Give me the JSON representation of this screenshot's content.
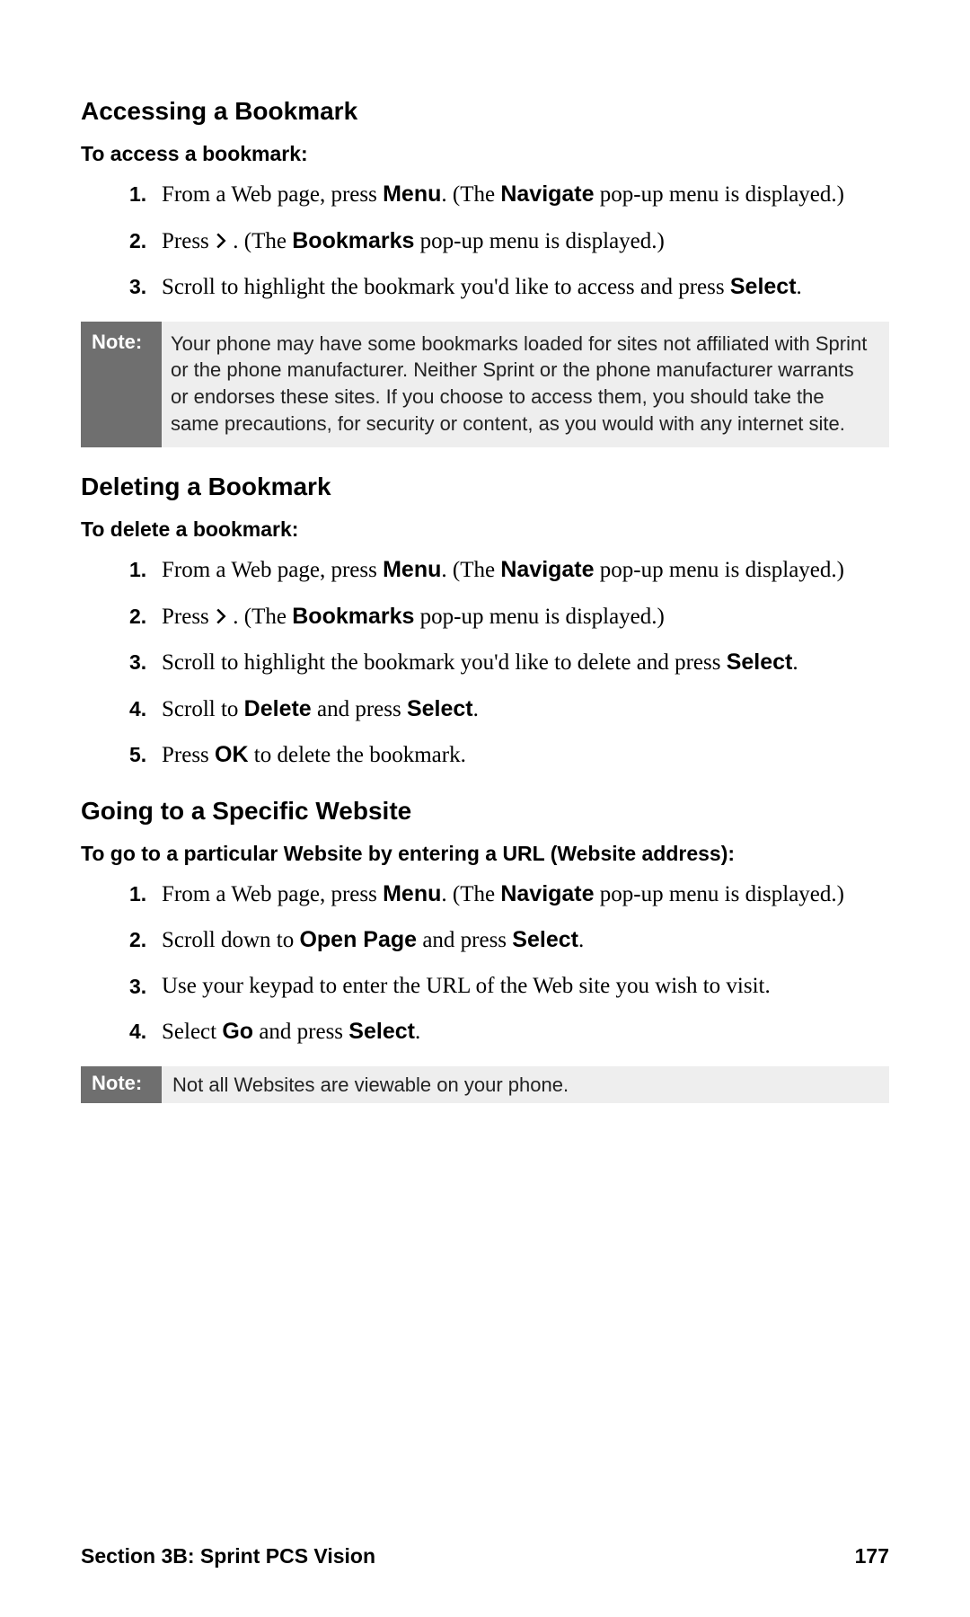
{
  "section1": {
    "heading": "Accessing a Bookmark",
    "subheading": "To access a bookmark:",
    "steps": [
      {
        "n": "1.",
        "pre": "From a Web page, press ",
        "b1": "Menu",
        "mid1": ". (The ",
        "b2": "Navigate",
        "post": " pop-up menu is displayed.)"
      },
      {
        "n": "2.",
        "pre": "Press ",
        "glyph": true,
        "mid1": " . (The ",
        "b1": "Bookmarks",
        "post": " pop-up menu is displayed.)"
      },
      {
        "n": "3.",
        "pre": "Scroll to highlight the bookmark you'd like to access and press ",
        "b1": "Select",
        "post": "."
      }
    ]
  },
  "note1": {
    "label": "Note:",
    "body": "Your phone may have some bookmarks loaded for sites not affiliated with Sprint or the phone manufacturer.  Neither Sprint or the phone manufacturer warrants or endorses these sites. If you choose to access them, you should take the same precautions, for security or content, as you would with any internet site."
  },
  "section2": {
    "heading": "Deleting a Bookmark",
    "subheading": "To delete a bookmark:",
    "steps": [
      {
        "n": "1.",
        "pre": "From a Web page, press ",
        "b1": "Menu",
        "mid1": ". (The ",
        "b2": "Navigate",
        "post": " pop-up menu is displayed.)"
      },
      {
        "n": "2.",
        "pre": "Press ",
        "glyph": true,
        "mid1": " . (The ",
        "b1": "Bookmarks",
        "post": " pop-up menu is displayed.)"
      },
      {
        "n": "3.",
        "pre": "Scroll to highlight the bookmark you'd like to delete and press ",
        "b1": "Select",
        "post": "."
      },
      {
        "n": "4.",
        "pre": "Scroll to ",
        "b1": "Delete",
        "mid1": " and press ",
        "b2": "Select",
        "post": "."
      },
      {
        "n": "5.",
        "pre": "Press ",
        "b1": "OK",
        "post": " to delete the bookmark."
      }
    ]
  },
  "section3": {
    "heading": "Going to a Specific Website",
    "subheading": "To go to a particular Website by entering a URL (Website address):",
    "steps": [
      {
        "n": "1.",
        "pre": "From a Web page, press ",
        "b1": "Menu",
        "mid1": ". (The ",
        "b2": "Navigate",
        "post": " pop-up menu is displayed.)"
      },
      {
        "n": "2.",
        "pre": "Scroll down to ",
        "b1": "Open Page",
        "mid1": " and press ",
        "b2": "Select",
        "post": "."
      },
      {
        "n": "3.",
        "pre": "Use your keypad to enter the URL of the Web site you wish to visit.",
        "post": ""
      },
      {
        "n": "4.",
        "pre": "Select ",
        "b1": "Go",
        "mid1": " and press ",
        "b2": "Select",
        "post": "."
      }
    ]
  },
  "note2": {
    "label": "Note:",
    "body": "Not all Websites are viewable on your phone."
  },
  "footer": {
    "left": "Section 3B: Sprint PCS Vision",
    "right": "177"
  }
}
